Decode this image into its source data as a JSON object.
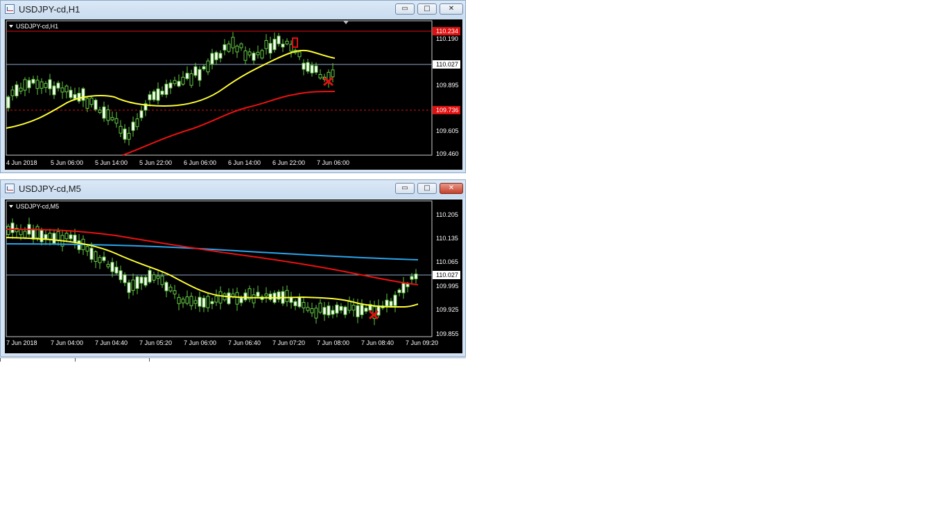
{
  "windows": [
    {
      "title": "USDJPY-cd,H1",
      "chart_label": "USDJPY-cd,H1",
      "price_ticks": [
        "110.190",
        "109.895",
        "109.605",
        "109.460"
      ],
      "current_price": "110.027",
      "upper_level": "110.234",
      "lower_level": "109.736",
      "time_ticks": [
        "4 Jun 2018",
        "5 Jun 06:00",
        "5 Jun 14:00",
        "5 Jun 22:00",
        "6 Jun 06:00",
        "6 Jun 14:00",
        "6 Jun 22:00",
        "7 Jun 06:00"
      ],
      "controls": {
        "minimize": "▭",
        "maximize": "□",
        "close": "✕"
      }
    },
    {
      "title": "USDJPY-cd,M5",
      "chart_label": "USDJPY-cd,M5",
      "price_ticks": [
        "110.205",
        "110.135",
        "110.065",
        "109.995",
        "109.925",
        "109.855"
      ],
      "current_price": "110.027",
      "time_ticks": [
        "7 Jun 2018",
        "7 Jun 04:00",
        "7 Jun 04:40",
        "7 Jun 05:20",
        "7 Jun 06:00",
        "7 Jun 06:40",
        "7 Jun 07:20",
        "7 Jun 08:00",
        "7 Jun 08:40",
        "7 Jun 09:20"
      ],
      "controls": {
        "minimize": "▭",
        "maximize": "□",
        "close": "✕"
      }
    }
  ],
  "colors": {
    "ma_fast": "#ffff33",
    "ma_slow": "#ee1111",
    "ma_long": "#2aa6ee",
    "candle_up": "#ffffff",
    "candle_wick": "#66cc44",
    "level_line": "#e01010",
    "current_line": "#8fa8c8"
  },
  "chart_data": [
    {
      "type": "candlestick",
      "symbol": "USDJPY-cd",
      "timeframe": "H1",
      "ylim": [
        109.46,
        110.25
      ],
      "current_price": 110.027,
      "levels": [
        110.234,
        109.736
      ],
      "moving_averages": [
        {
          "color": "yellow",
          "values": [
            109.62,
            109.66,
            109.72,
            109.78,
            109.82,
            109.84,
            109.84,
            109.8,
            109.77,
            109.77,
            109.78,
            109.82,
            109.87,
            109.94,
            110.01,
            110.06,
            110.1,
            110.14,
            110.16,
            110.17,
            110.15,
            110.13
          ]
        },
        {
          "color": "red",
          "values": [
            109.47,
            109.5,
            109.53,
            109.57,
            109.6,
            109.63,
            109.66,
            109.7,
            109.72,
            109.75,
            109.78,
            109.8,
            109.82,
            109.85,
            109.86,
            109.87
          ]
        }
      ]
    },
    {
      "type": "candlestick",
      "symbol": "USDJPY-cd",
      "timeframe": "M5",
      "ylim": [
        109.855,
        110.23
      ],
      "current_price": 110.027,
      "moving_averages": [
        {
          "color": "yellow",
          "values": [
            110.13,
            110.12,
            110.1,
            110.08,
            110.05,
            110.02,
            109.99,
            109.97,
            109.965,
            109.96,
            109.955,
            109.955,
            109.955,
            109.95,
            109.945,
            109.94,
            109.935,
            109.94
          ]
        },
        {
          "color": "red",
          "values": [
            110.16,
            110.155,
            110.145,
            110.13,
            110.115,
            110.1,
            110.09,
            110.08,
            110.07,
            110.06,
            110.05,
            110.04,
            110.03,
            110.02,
            110.005,
            109.995
          ]
        },
        {
          "color": "blue",
          "values": [
            110.12,
            110.115,
            110.11,
            110.105,
            110.1,
            110.09,
            110.085,
            110.08,
            110.075,
            110.07,
            110.065,
            110.065
          ]
        }
      ]
    }
  ]
}
